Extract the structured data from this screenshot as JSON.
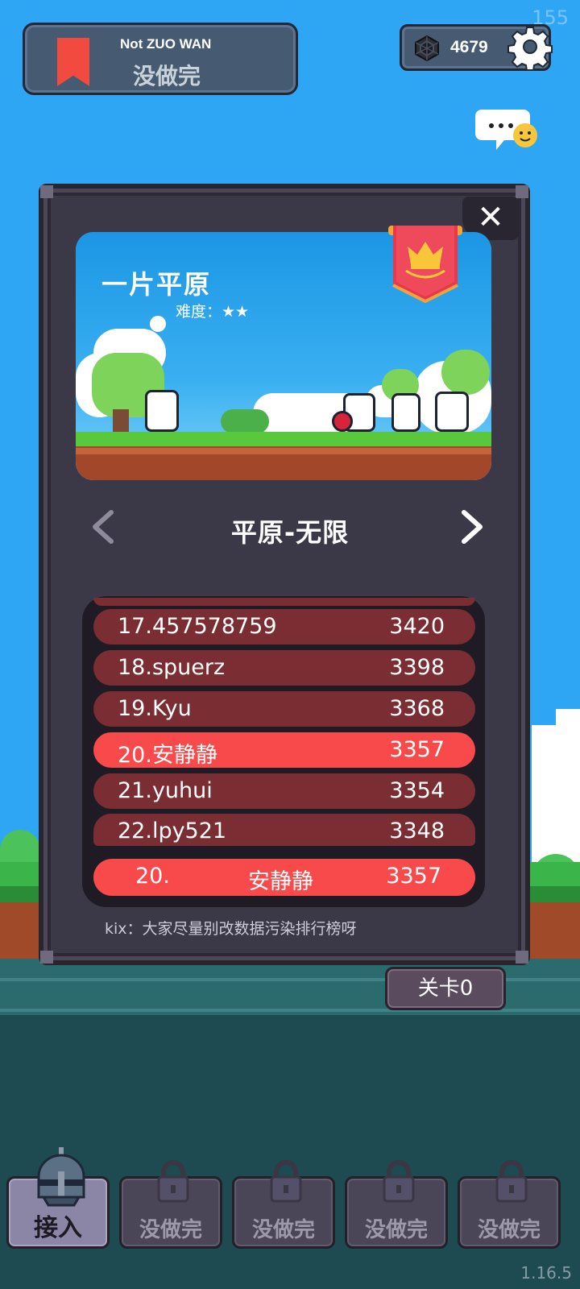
{
  "fps_counter": "155",
  "version": "1.16.5",
  "header": {
    "subtitle": "Not ZUO WAN",
    "title": "没做完",
    "gem_count": "4679"
  },
  "card": {
    "title": "一片平原",
    "difficulty": "难度：★★"
  },
  "mode": {
    "title": "平原-无限"
  },
  "leaderboard": {
    "rows": [
      {
        "rank_name": "17.457578759",
        "score": "3420"
      },
      {
        "rank_name": "18.spuerz",
        "score": "3398"
      },
      {
        "rank_name": "19.Kyu",
        "score": "3368"
      },
      {
        "rank_name": "20.安静静",
        "score": "3357"
      },
      {
        "rank_name": "21.yuhui",
        "score": "3354"
      },
      {
        "rank_name": "22.lpy521",
        "score": "3348"
      }
    ],
    "mine": {
      "rank": "20.",
      "name": "安静静",
      "score": "3357"
    }
  },
  "tip": "kix：大家尽量别改数据污染排行榜呀",
  "stage_button": "关卡0",
  "bottom_bar": {
    "slots": [
      "接入",
      "没做完",
      "没做完",
      "没做完",
      "没做完"
    ]
  },
  "colors": {
    "sky": "#2ea6f4",
    "panel": "#3b3848",
    "row": "#7a2d33",
    "highlight": "#f84a4a",
    "banner": "#e8384a"
  },
  "icons": [
    "bookmark-icon",
    "gem-icon",
    "gear-icon",
    "chat-icon",
    "close-icon",
    "crown-banner-icon",
    "chevron-left-icon",
    "chevron-right-icon",
    "knight-helmet-icon",
    "lock-icon"
  ]
}
